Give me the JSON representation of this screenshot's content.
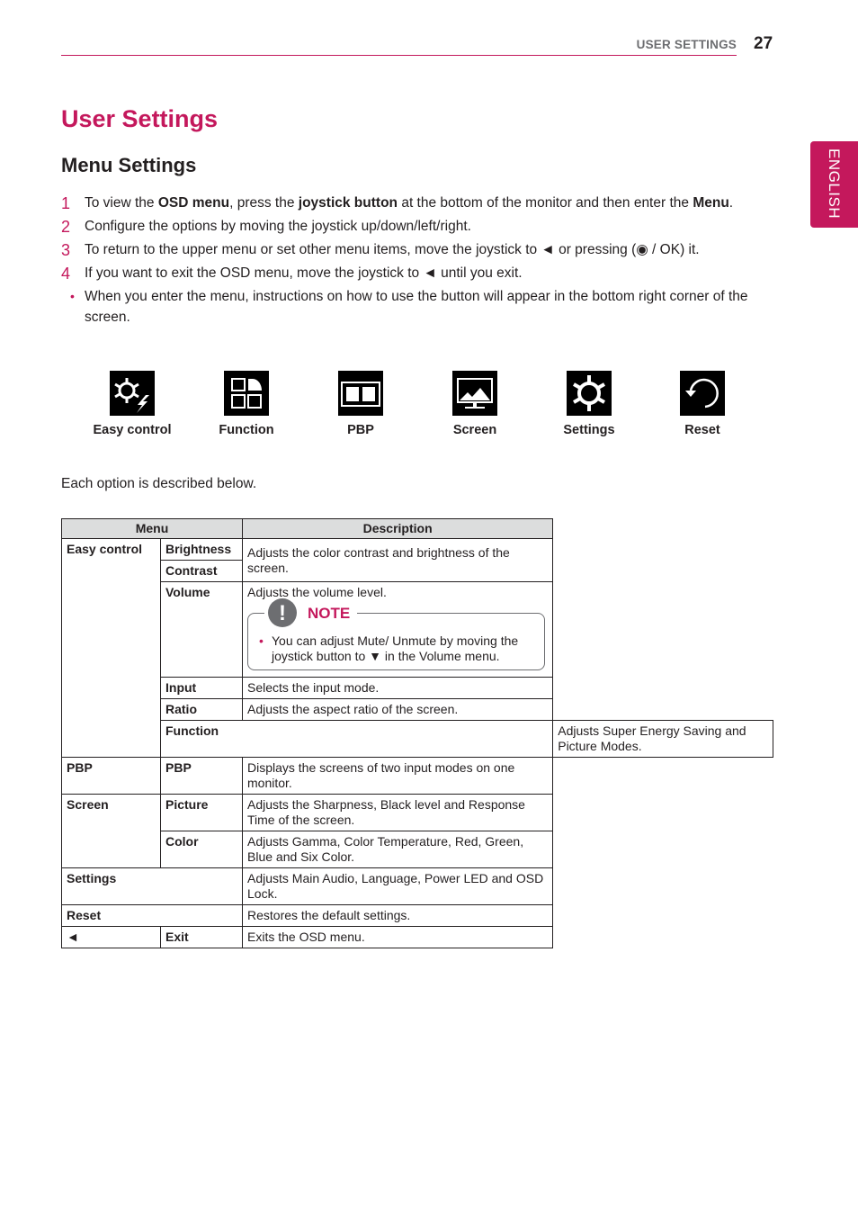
{
  "header": {
    "section": "USER SETTINGS",
    "page_number": "27"
  },
  "language_tab": "ENGLISH",
  "title": "User Settings",
  "subtitle": "Menu Settings",
  "steps": [
    {
      "marker": "1",
      "parts": [
        {
          "t": "To view the ",
          "b": false
        },
        {
          "t": "OSD menu",
          "b": true
        },
        {
          "t": ", press the ",
          "b": false
        },
        {
          "t": "joystick button",
          "b": true
        },
        {
          "t": " at the bottom of the monitor and then enter the ",
          "b": false
        },
        {
          "t": "Menu",
          "b": true
        },
        {
          "t": ".",
          "b": false
        }
      ]
    },
    {
      "marker": "2",
      "parts": [
        {
          "t": "Configure the options by moving the joystick up/down/left/right.",
          "b": false
        }
      ]
    },
    {
      "marker": "3",
      "parts": [
        {
          "t": "To return to the upper menu or set other menu items, move the joystick to ◄ or pressing (◉ / OK) it.",
          "b": false
        }
      ]
    },
    {
      "marker": "4",
      "parts": [
        {
          "t": "If you want to exit the OSD menu, move the joystick to ◄ until you exit.",
          "b": false
        }
      ]
    },
    {
      "marker": "•",
      "parts": [
        {
          "t": "When you enter the menu, instructions on how to use the button will appear in the bottom right corner of the screen.",
          "b": false
        }
      ]
    }
  ],
  "menu_icons": [
    {
      "label": "Easy control",
      "icon": "gear-lightning-icon"
    },
    {
      "label": "Function",
      "icon": "grid-quadrant-icon"
    },
    {
      "label": "PBP",
      "icon": "split-screen-icon"
    },
    {
      "label": "Screen",
      "icon": "monitor-landscape-icon"
    },
    {
      "label": "Settings",
      "icon": "gear-icon"
    },
    {
      "label": "Reset",
      "icon": "reset-arrow-icon"
    }
  ],
  "intro": "Each option is described below.",
  "table": {
    "headers": {
      "menu": "Menu",
      "description": "Description"
    },
    "rows": {
      "easy_control": "Easy control",
      "brightness": "Brightness",
      "contrast": "Contrast",
      "brightness_contrast_desc": "Adjusts the color contrast and brightness of the screen.",
      "volume": "Volume",
      "volume_desc": "Adjusts the volume level.",
      "note_title": "NOTE",
      "note_text": "You can adjust Mute/ Unmute by moving the joystick button to ▼ in the Volume menu.",
      "input": "Input",
      "input_desc": "Selects the input mode.",
      "ratio": "Ratio",
      "ratio_desc": "Adjusts the aspect ratio of the screen.",
      "function": "Function",
      "function_desc": "Adjusts Super Energy Saving and Picture Modes.",
      "pbp": "PBP",
      "pbp_sub": "PBP",
      "pbp_desc": "Displays the screens of two input modes on one monitor.",
      "screen": "Screen",
      "picture": "Picture",
      "picture_desc": "Adjusts the Sharpness, Black level and Response Time of the screen.",
      "color": "Color",
      "color_desc": "Adjusts Gamma, Color Temperature, Red, Green, Blue and Six Color.",
      "settings": "Settings",
      "settings_desc": "Adjusts Main Audio, Language, Power LED and OSD Lock.",
      "reset": "Reset",
      "reset_desc": "Restores the default settings.",
      "back_symbol": "◄",
      "exit": "Exit",
      "exit_desc": "Exits the OSD menu."
    }
  },
  "colors": {
    "accent": "#c4185c",
    "table_header_bg": "#dcdddd",
    "note_icon": "#6d6e71"
  }
}
